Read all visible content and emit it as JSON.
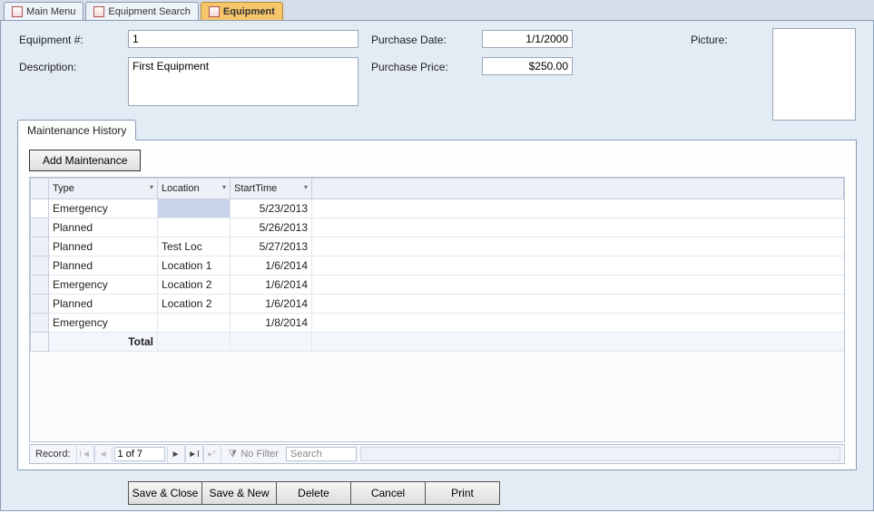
{
  "tabs": [
    {
      "label": "Main Menu",
      "active": false
    },
    {
      "label": "Equipment Search",
      "active": false
    },
    {
      "label": "Equipment",
      "active": true
    }
  ],
  "form": {
    "equipment_num_label": "Equipment #:",
    "equipment_num": "1",
    "description_label": "Description:",
    "description": "First Equipment",
    "purchase_date_label": "Purchase Date:",
    "purchase_date": "1/1/2000",
    "purchase_price_label": "Purchase Price:",
    "purchase_price": "$250.00",
    "picture_label": "Picture:"
  },
  "subform": {
    "tab_label": "Maintenance History",
    "add_button": "Add Maintenance",
    "columns": {
      "type": "Type",
      "location": "Location",
      "start": "StartTime"
    },
    "rows": [
      {
        "type": "Emergency",
        "location": "",
        "start": "5/23/2013",
        "selected": true
      },
      {
        "type": "Planned",
        "location": "",
        "start": "5/26/2013"
      },
      {
        "type": "Planned",
        "location": "Test Loc",
        "start": "5/27/2013"
      },
      {
        "type": "Planned",
        "location": "Location 1",
        "start": "1/6/2014"
      },
      {
        "type": "Emergency",
        "location": "Location 2",
        "start": "1/6/2014"
      },
      {
        "type": "Planned",
        "location": "Location 2",
        "start": "1/6/2014"
      },
      {
        "type": "Emergency",
        "location": "",
        "start": "1/8/2014"
      }
    ],
    "total_label": "Total"
  },
  "recnav": {
    "label": "Record:",
    "position": "1 of 7",
    "filter_label": "No Filter",
    "search_placeholder": "Search"
  },
  "actions": {
    "save_close": "Save & Close",
    "save_new": "Save & New",
    "delete": "Delete",
    "cancel": "Cancel",
    "print": "Print"
  }
}
